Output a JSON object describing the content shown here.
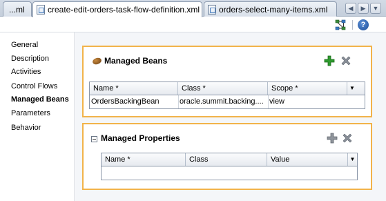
{
  "tabs": [
    {
      "label": "...ml",
      "active": false
    },
    {
      "label": "create-edit-orders-task-flow-definition.xml",
      "active": true,
      "close": "✕"
    },
    {
      "label": "orders-select-many-items.xml",
      "active": false
    }
  ],
  "tab_nav": {
    "left": "◀",
    "right": "▶",
    "menu": "▼"
  },
  "toolbar": {
    "help_label": "?"
  },
  "sidebar": {
    "items": [
      {
        "label": "General",
        "selected": false
      },
      {
        "label": "Description",
        "selected": false
      },
      {
        "label": "Activities",
        "selected": false
      },
      {
        "label": "Control Flows",
        "selected": false
      },
      {
        "label": "Managed Beans",
        "selected": true
      },
      {
        "label": "Parameters",
        "selected": false
      },
      {
        "label": "Behavior",
        "selected": false
      }
    ]
  },
  "managed_beans": {
    "title": "Managed Beans",
    "columns": [
      "Name *",
      "Class *",
      "Scope *"
    ],
    "rows": [
      {
        "name": "OrdersBackingBean",
        "class": "oracle.summit.backing....",
        "scope": "view"
      }
    ]
  },
  "managed_properties": {
    "title": "Managed Properties",
    "columns": [
      "Name *",
      "Class",
      "Value"
    ],
    "rows": []
  },
  "colors": {
    "section_border": "#f2b34a",
    "add_enabled": "#2e9a2e",
    "add_disabled": "#8a8f96",
    "delete": "#707780"
  }
}
